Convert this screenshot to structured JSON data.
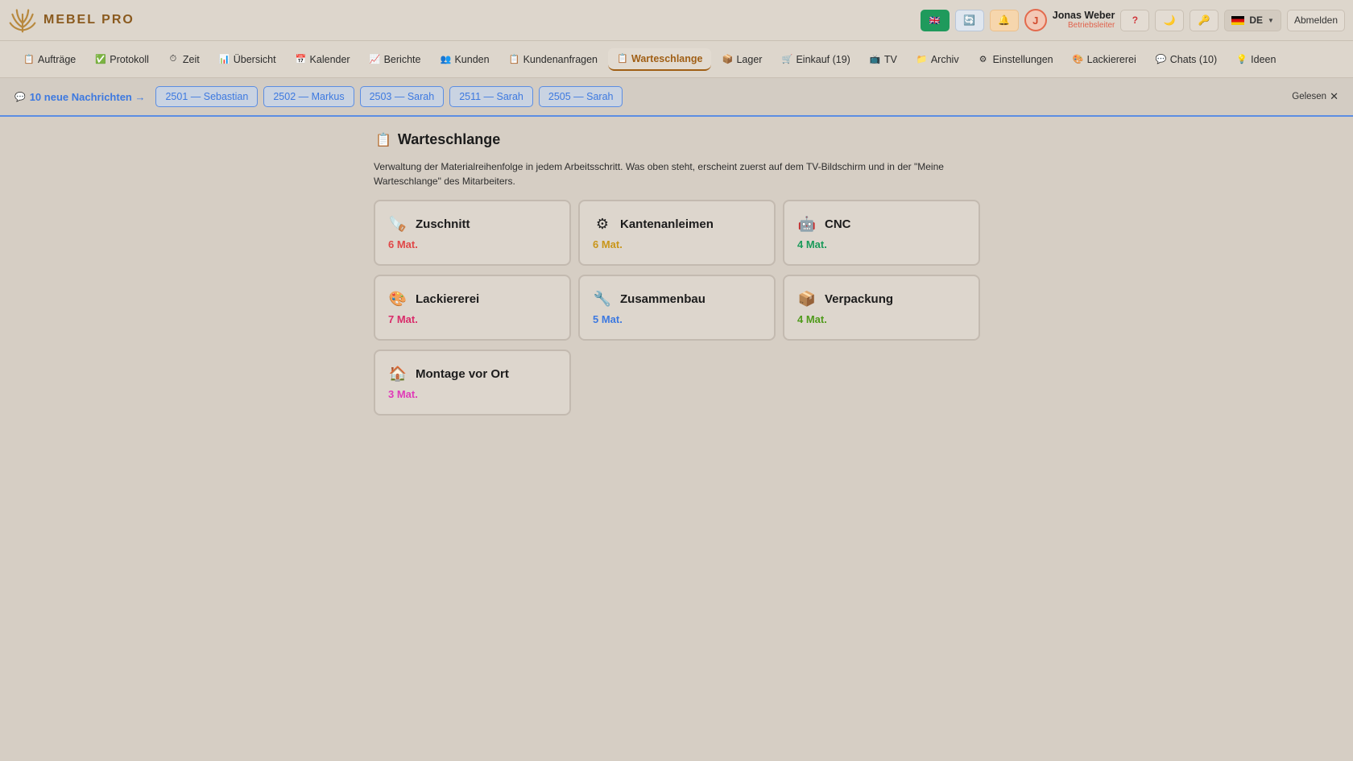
{
  "app": {
    "name": "MEBEL PRO"
  },
  "header": {
    "user_initial": "J",
    "user_name": "Jonas Weber",
    "user_role": "Betriebsleiter",
    "help_label": "?",
    "lang_label": "DE",
    "logout_label": "Abmelden"
  },
  "nav": {
    "items": [
      {
        "label": "Aufträge",
        "icon": "📋"
      },
      {
        "label": "Protokoll",
        "icon": "✅"
      },
      {
        "label": "Zeit",
        "icon": "⏱"
      },
      {
        "label": "Übersicht",
        "icon": "📊"
      },
      {
        "label": "Kalender",
        "icon": "📅"
      },
      {
        "label": "Berichte",
        "icon": "📈"
      },
      {
        "label": "Kunden",
        "icon": "👥"
      },
      {
        "label": "Kundenanfragen",
        "icon": "📋"
      },
      {
        "label": "Warteschlange",
        "icon": "📋"
      },
      {
        "label": "Lager",
        "icon": "📦"
      },
      {
        "label": "Einkauf (19)",
        "icon": "🛒"
      },
      {
        "label": "TV",
        "icon": "📺"
      },
      {
        "label": "Archiv",
        "icon": "📁"
      },
      {
        "label": "Einstellungen",
        "icon": "⚙"
      },
      {
        "label": "Lackiererei",
        "icon": "🎨"
      },
      {
        "label": "Chats (10)",
        "icon": "💬"
      },
      {
        "label": "Ideen",
        "icon": "💡"
      }
    ],
    "active": "Warteschlange"
  },
  "notifications": {
    "title": "10 neue Nachrichten →",
    "chips": [
      "2501 — Sebastian",
      "2502 — Markus",
      "2503 — Sarah",
      "2511 — Sarah",
      "2505 — Sarah"
    ],
    "read_label": "Gelesen"
  },
  "page": {
    "title": "Warteschlange",
    "description": "Verwaltung der Materialreihenfolge in jedem Arbeitsschritt. Was oben steht, erscheint zuerst auf dem TV-Bildschirm und in der \"Meine Warteschlange\" des Mitarbeiters."
  },
  "stations": [
    {
      "name": "Zuschnitt",
      "count": "6 Mat.",
      "icon": "🪚",
      "color": "#e04848"
    },
    {
      "name": "Kantenanleimen",
      "count": "6 Mat.",
      "icon": "⚙",
      "color": "#c9961a"
    },
    {
      "name": "CNC",
      "count": "4 Mat.",
      "icon": "🤖",
      "color": "#1a9a5a"
    },
    {
      "name": "Lackiererei",
      "count": "7 Mat.",
      "icon": "🎨",
      "color": "#d92c6a"
    },
    {
      "name": "Zusammenbau",
      "count": "5 Mat.",
      "icon": "🔧",
      "color": "#3d79e0"
    },
    {
      "name": "Verpackung",
      "count": "4 Mat.",
      "icon": "📦",
      "color": "#4f9a1a"
    },
    {
      "name": "Montage vor Ort",
      "count": "3 Mat.",
      "icon": "🏠",
      "color": "#e03ab8"
    }
  ]
}
